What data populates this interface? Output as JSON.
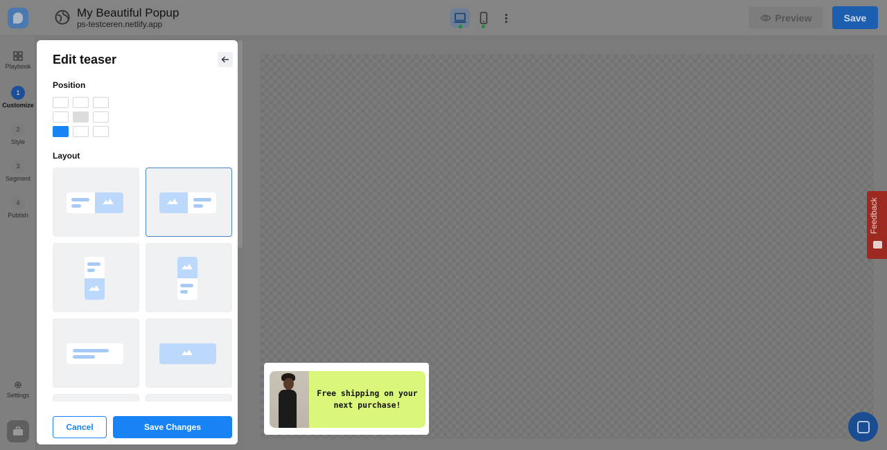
{
  "header": {
    "title": "My Beautiful Popup",
    "url": "ps-testceren.netlify.app",
    "preview_label": "Preview",
    "save_label": "Save",
    "devices": [
      "desktop",
      "mobile"
    ],
    "active_device": "desktop"
  },
  "sidebar": {
    "items": [
      {
        "label": "Playbook",
        "icon": "grid-icon"
      },
      {
        "number": "1",
        "label": "Customize",
        "active": true
      },
      {
        "number": "2",
        "label": "Style"
      },
      {
        "number": "3",
        "label": "Segment"
      },
      {
        "number": "4",
        "label": "Publish"
      }
    ],
    "settings_label": "Settings"
  },
  "panel": {
    "title": "Edit teaser",
    "position_label": "Position",
    "layout_label": "Layout",
    "position_selected": "bottom-left",
    "layout_selected": 2,
    "cancel_label": "Cancel",
    "save_label": "Save Changes"
  },
  "teaser": {
    "text": "Free shipping on your next purchase!",
    "accent_color": "#dbf779"
  },
  "feedback_label": "Feedback",
  "colors": {
    "primary": "#1783f5",
    "feedback": "#c0392b"
  }
}
